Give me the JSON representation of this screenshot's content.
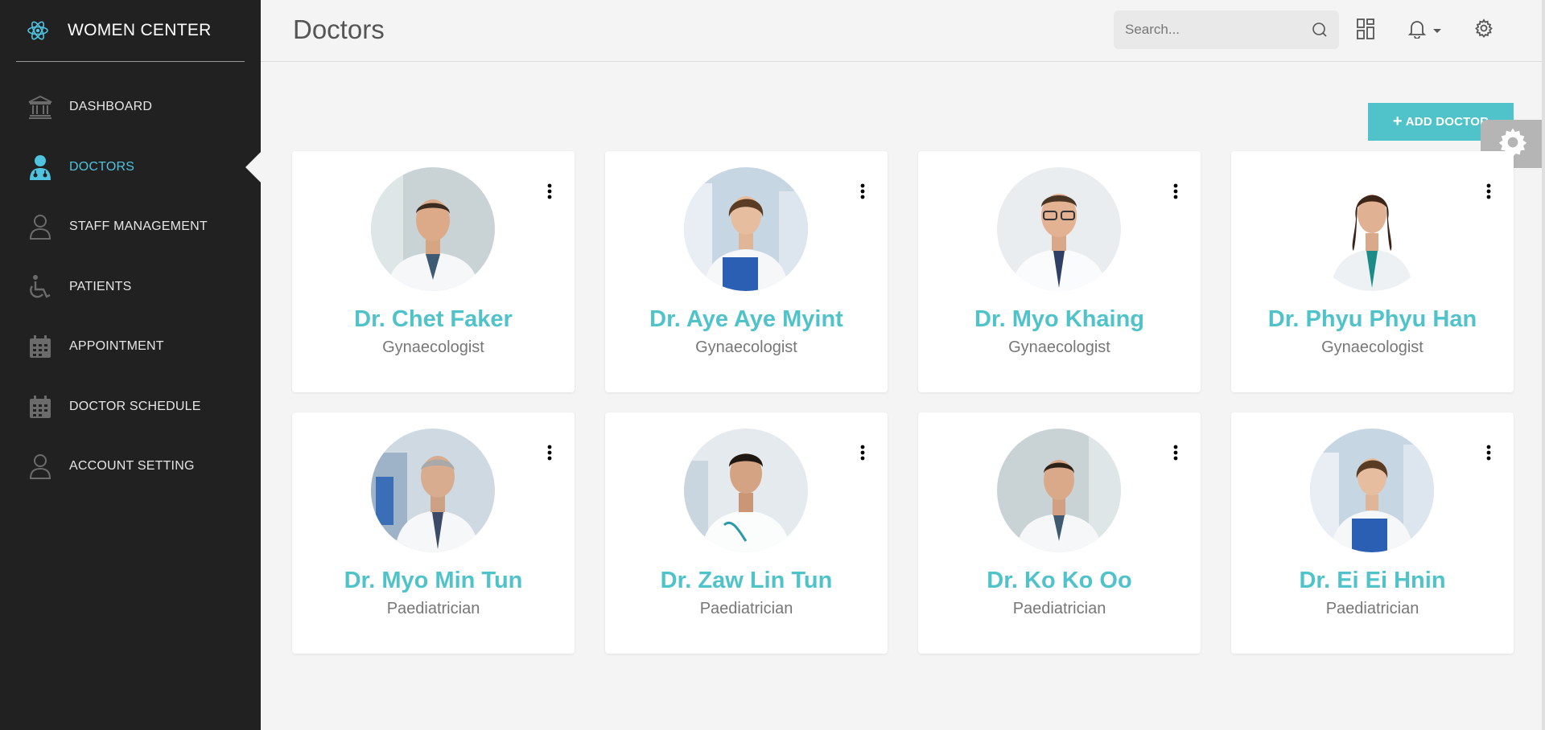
{
  "colors": {
    "accent": "#4fc3c9",
    "nav_active": "#4fc3e0",
    "sidebar_bg": "#212121",
    "page_bg": "#f4f4f4"
  },
  "sidebar": {
    "brand": {
      "name": "WOMEN CENTER",
      "icon": "react-atom-icon"
    },
    "items": [
      {
        "label": "DASHBOARD",
        "icon": "bank-icon",
        "active": false
      },
      {
        "label": "DOCTORS",
        "icon": "doctor-icon",
        "active": true
      },
      {
        "label": "STAFF MANAGEMENT",
        "icon": "user-icon",
        "active": false
      },
      {
        "label": "PATIENTS",
        "icon": "wheelchair-icon",
        "active": false
      },
      {
        "label": "APPOINTMENT",
        "icon": "calendar-icon",
        "active": false
      },
      {
        "label": "DOCTOR SCHEDULE",
        "icon": "calendar-icon",
        "active": false
      },
      {
        "label": "ACCOUNT SETTING",
        "icon": "user-icon",
        "active": false
      }
    ]
  },
  "header": {
    "title": "Doctors",
    "search_placeholder": "Search...",
    "icons": [
      "search-icon",
      "dashboard-grid-icon",
      "bell-icon",
      "chevron-down-icon",
      "gear-icon"
    ]
  },
  "main": {
    "add_button_label": "ADD DOCTOR",
    "doctors": [
      {
        "name": "Dr. Chet Faker",
        "specialty": "Gynaecologist"
      },
      {
        "name": "Dr. Aye Aye Myint",
        "specialty": "Gynaecologist"
      },
      {
        "name": "Dr. Myo Khaing",
        "specialty": "Gynaecologist"
      },
      {
        "name": "Dr. Phyu Phyu Han",
        "specialty": "Gynaecologist"
      },
      {
        "name": "Dr. Myo Min Tun",
        "specialty": "Paediatrician"
      },
      {
        "name": "Dr. Zaw Lin Tun",
        "specialty": "Paediatrician"
      },
      {
        "name": "Dr. Ko Ko Oo",
        "specialty": "Paediatrician"
      },
      {
        "name": "Dr. Ei Ei Hnin",
        "specialty": "Paediatrician"
      }
    ]
  }
}
